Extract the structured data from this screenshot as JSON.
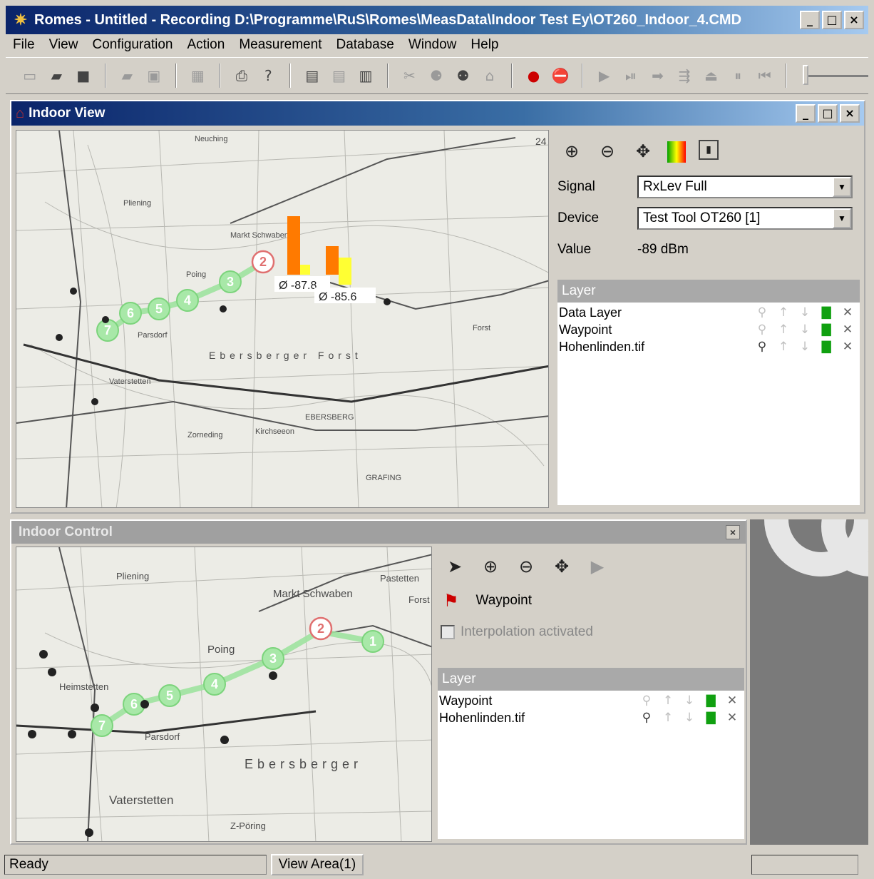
{
  "window": {
    "title": "Romes - Untitled - Recording D:\\Programme\\RuS\\Romes\\MeasData\\Indoor Test Ey\\OT260_Indoor_4.CMD",
    "buttons": [
      "_",
      "□",
      "×"
    ]
  },
  "menu": [
    "File",
    "View",
    "Configuration",
    "Action",
    "Measurement",
    "Database",
    "Window",
    "Help"
  ],
  "indoor_view": {
    "title": "Indoor View",
    "signal_label": "Signal",
    "signal_value": "RxLev Full",
    "device_label": "Device",
    "device_value": "Test Tool OT260 [1]",
    "value_label": "Value",
    "value_value": "-89 dBm",
    "layer_header": "Layer",
    "layers": [
      "Data Layer",
      "Waypoint",
      "Hohenlinden.tif"
    ],
    "avg1": "Ø -87.8",
    "avg2": "Ø -85.6",
    "map_labels": [
      "Markt Schwaben",
      "Ebersberger Forst",
      "Vaterstetten",
      "EBERSBERG",
      "Forst",
      "Parsdorf",
      "Kirchseeon",
      "Zorneding",
      "GRAFING",
      "Poing",
      "Neuching",
      "Pliening"
    ],
    "waypoints": [
      "2",
      "3",
      "4",
      "5",
      "6",
      "7"
    ],
    "grid_number": "24"
  },
  "indoor_control": {
    "title": "Indoor Control",
    "waypoint_label": "Waypoint",
    "interpolation_label": "Interpolation activated",
    "layer_header": "Layer",
    "layers": [
      "Waypoint",
      "Hohenlinden.tif"
    ],
    "map_labels": [
      "Markt Schwaben",
      "Ebersberger",
      "Vaterstetten",
      "Parsdorf",
      "Poing",
      "Pliening",
      "Forst",
      "Z-Pöring",
      "Pastetten",
      "Heimstetten"
    ],
    "waypoints": [
      "1",
      "2",
      "3",
      "4",
      "5",
      "6",
      "7"
    ]
  },
  "status": {
    "ready": "Ready",
    "view_area": "View Area(1)"
  }
}
